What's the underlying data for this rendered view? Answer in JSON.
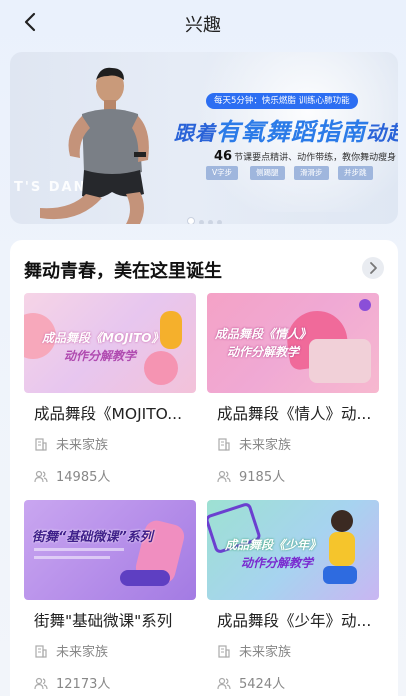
{
  "header": {
    "title": "兴趣"
  },
  "banner": {
    "pill": "每天5分钟：快乐燃脂 训练心肺功能",
    "headline_pre": "跟着",
    "headline_big": "有氧舞蹈指南",
    "headline_post": "动起",
    "desc_num": "46",
    "desc_text": "节课要点精讲、动作带练，教你舞动瘦身",
    "tags": [
      "V字步",
      "侧踢腿",
      "滑滑步",
      "并步跳"
    ],
    "watermark": "T'S DANCE",
    "slides": 4,
    "active_slide": 0
  },
  "section": {
    "title": "舞动青春，美在这里诞生",
    "cards": [
      {
        "thumb_title_1": "成品舞段《MOJITO》",
        "thumb_title_2": "动作分解教学",
        "name": "成品舞段《MOJITO...",
        "author": "未来家族",
        "count": "14985人"
      },
      {
        "thumb_title_1": "成品舞段《情人》",
        "thumb_title_2": "动作分解教学",
        "name": "成品舞段《情人》动...",
        "author": "未来家族",
        "count": "9185人"
      },
      {
        "thumb_title_1": "街舞“基础微课”系列",
        "thumb_title_2": "",
        "name": "街舞\"基础微课\"系列",
        "author": "未来家族",
        "count": "12173人"
      },
      {
        "thumb_title_1": "成品舞段《少年》",
        "thumb_title_2": "动作分解教学",
        "name": "成品舞段《少年》动...",
        "author": "未来家族",
        "count": "5424人"
      }
    ]
  }
}
